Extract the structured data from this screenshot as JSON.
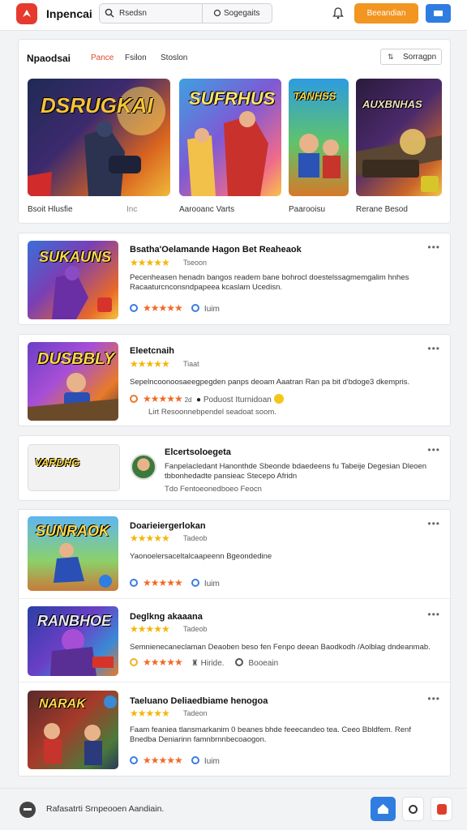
{
  "header": {
    "app_title": "Inpencai",
    "search_placeholder": "Rsedsn",
    "search_secondary": "Sogegaits",
    "primary_button": "Beeandian",
    "colors": {
      "accent": "#f29521",
      "brand": "#e63a2e",
      "blue": "#2f7de0"
    }
  },
  "featured": {
    "title": "Npaodsai",
    "tabs": [
      "Pance",
      "Fsilon",
      "Stoslon"
    ],
    "sort_button": "Sorragpn",
    "tiles": [
      {
        "art_text": "DSRUGKAI",
        "caption": "Bsoit  Hlusfie"
      },
      {
        "art_text": "SUFRHUS",
        "caption": "Aarooanc  Varts"
      },
      {
        "art_text": "TANHSS",
        "caption": "Paarooisu"
      },
      {
        "art_text": "AUXBNHAS",
        "caption": "Rerane  Besod"
      }
    ],
    "extra_caption": "Inc"
  },
  "list": [
    {
      "art_text": "SUKAUNS",
      "title": "Bsatha'Oelamande Hagon Bet Reaheaok",
      "meta": "Tseoon",
      "desc": "Pecenheasen henadn bangos readem bane bohrocl doestelssagmemgalim hnhes Racaaturcnconsndpapeea kcaslam Ucedisn.",
      "foot_text": "Iuim"
    },
    {
      "art_text": "DUSBBLY",
      "title": "Eleetcnaih",
      "meta": "Tiaat",
      "desc": "Sepelncoonoosaeegpegden panps deoam Aaatran Ran pa bit d'bdoge3 dkempris.",
      "foot_count": "2d",
      "foot_text": "Poduost  Iturnidoan",
      "foot_sub": "Lirt  Resoonnebpendel seadoat soom."
    },
    {
      "art_text": "VARDHG",
      "title": "Elcertsoloegeta",
      "desc": "Fanpelacledant  Hanonthde Sbeonde bdaedeens fu Tabeije Degesian Dleoen tbbonhedadte pansieac Stecepo Afridn",
      "foot_sub": "Tdo  Fentoeonedboeo  Feocn"
    },
    {
      "art_text": "SUNRAOK",
      "title": "Doarieiergerlokan",
      "meta": "Tadeob",
      "desc": "Yaonoelersaceltalcaapeenn Bgeondedine",
      "foot_text": "Iuim"
    },
    {
      "art_text": "RANBHOE",
      "title": "Deglkng akaaana",
      "meta": "Tadeob",
      "desc": "Semnienecaneclaman Deaoben beso fen Fenpo deean Baodkodh /Aolblag dndeanmab.",
      "foot_text": "Hiride.",
      "foot_text2": "Booeain"
    },
    {
      "art_text": "NARAK",
      "title": "Taeluano Deliaedbiame henogoa",
      "meta": "Tadeon",
      "desc": "Faam feaniea tlansmarkanim 0 beanes bhde feeecandeo tea. Ceeo Bbldfem. Renf Bnedba Deniarinn famnbrnnbecoaogon.",
      "foot_text": "Iuim"
    }
  ],
  "bottom": {
    "status_text": "Rafasatrti Srnpeooen Aandiain."
  }
}
